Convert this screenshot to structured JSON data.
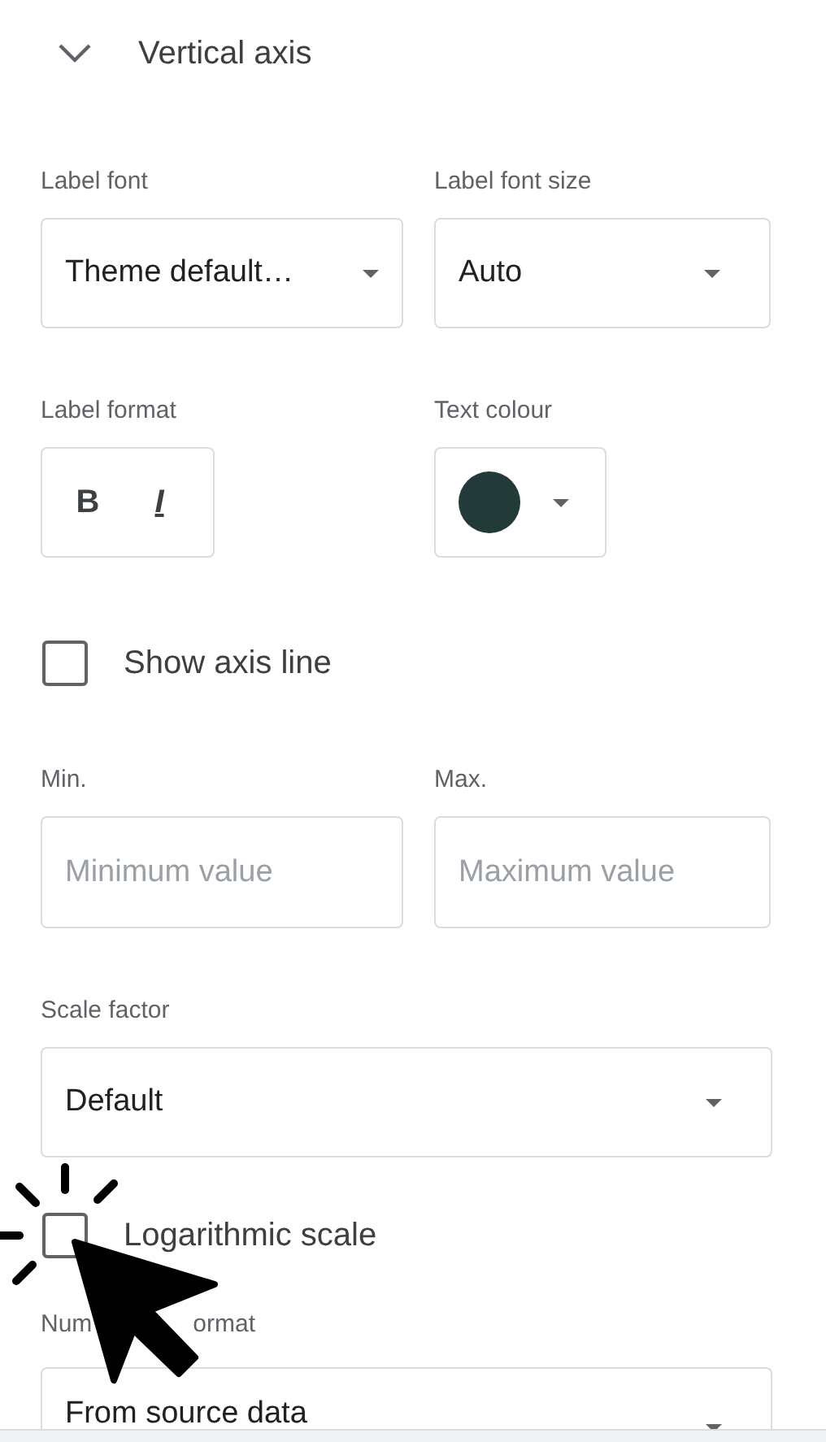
{
  "section": {
    "title": "Vertical axis",
    "expanded": true
  },
  "label_font": {
    "label": "Label font",
    "value": "Theme default…"
  },
  "label_font_size": {
    "label": "Label font size",
    "value": "Auto"
  },
  "label_format": {
    "label": "Label format",
    "buttons": [
      {
        "kind": "bold",
        "text": "B",
        "selected": false
      },
      {
        "kind": "italic",
        "text": "I",
        "selected": false
      }
    ]
  },
  "text_colour": {
    "label": "Text colour",
    "color": "#223a38"
  },
  "show_axis_line": {
    "label": "Show axis line",
    "checked": false
  },
  "min": {
    "label": "Min.",
    "placeholder": "Minimum value"
  },
  "max": {
    "label": "Max.",
    "placeholder": "Maximum value"
  },
  "scale_factor": {
    "label": "Scale factor",
    "value": "Default"
  },
  "logarithmic_scale": {
    "label": "Logarithmic scale",
    "checked": false
  },
  "number_format": {
    "label_parts": [
      "Num",
      "ormat"
    ],
    "value": "From source data"
  }
}
